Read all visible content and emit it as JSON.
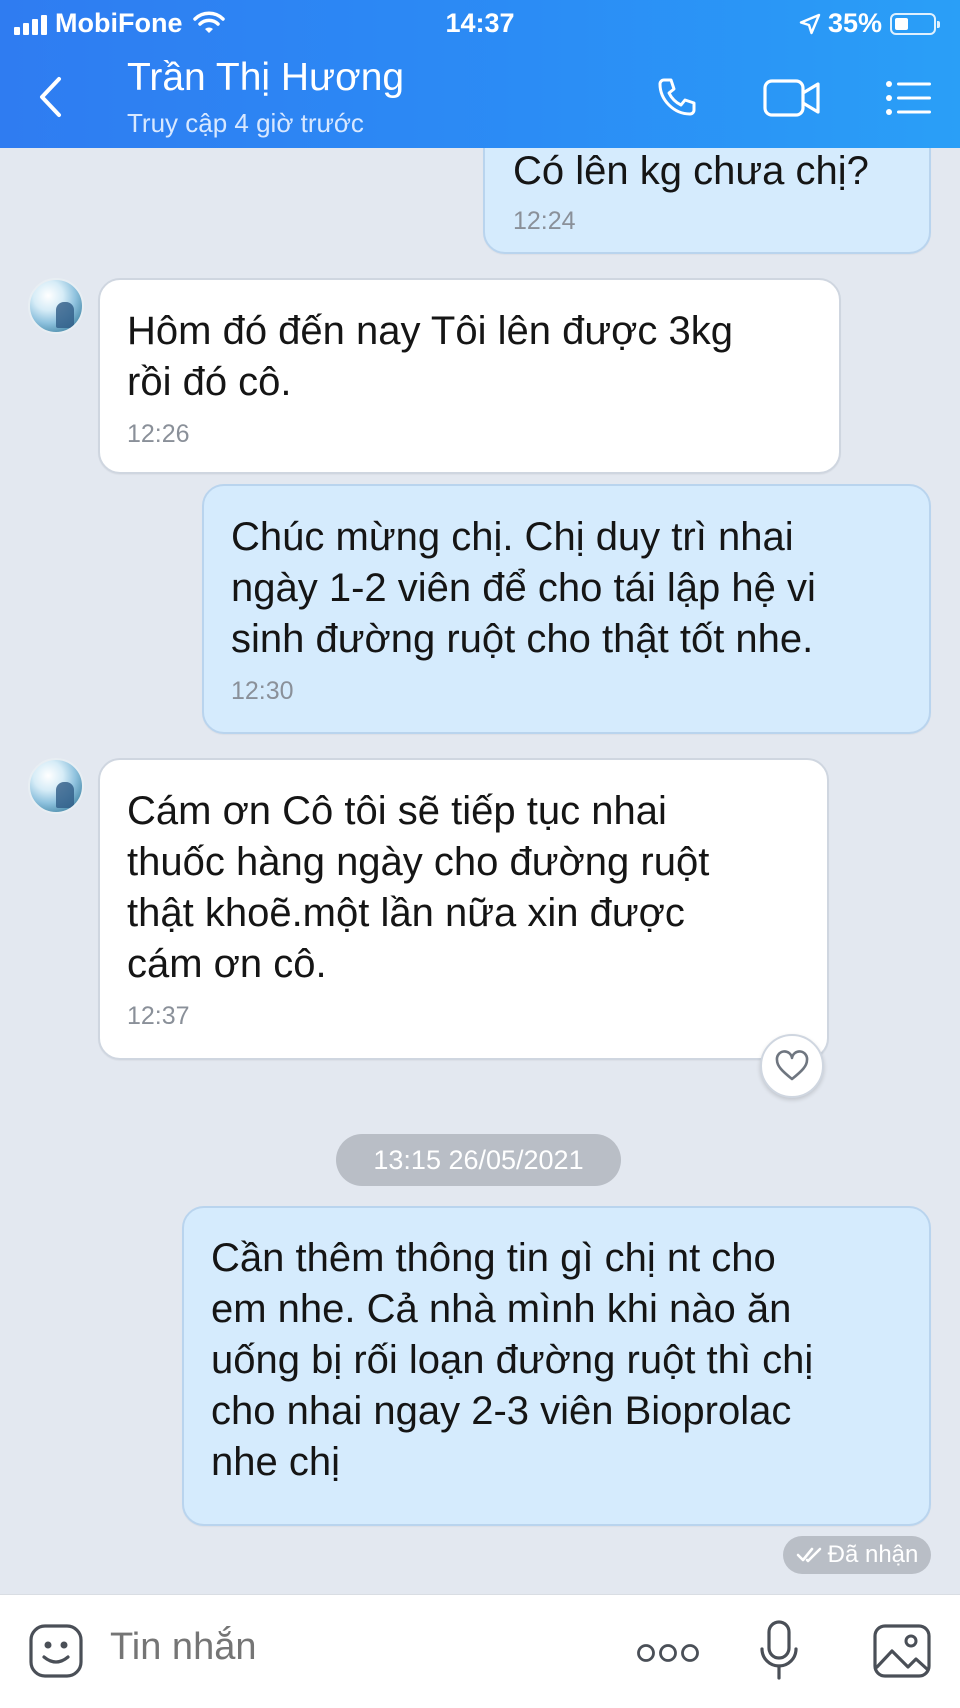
{
  "status_bar": {
    "carrier": "MobiFone",
    "time": "14:37",
    "battery": "35%"
  },
  "header": {
    "contact_name": "Trần Thị Hương",
    "contact_status": "Truy cập 4 giờ trước",
    "icons": [
      "back-chevron-icon",
      "phone-icon",
      "video-call-icon",
      "menu-list-icon"
    ]
  },
  "messages": [
    {
      "direction": "out",
      "text": "Có lên kg chưa chị?",
      "time": "12:24"
    },
    {
      "direction": "in",
      "text": "Hôm đó đến nay Tôi lên được 3kg\nrồi đó cô.",
      "time": "12:26"
    },
    {
      "direction": "out",
      "text": "Chúc mừng chị. Chị duy trì nhai\nngày 1-2 viên để cho tái lập hệ vi\nsinh đường ruột cho thật tốt nhe.",
      "time": "12:30"
    },
    {
      "direction": "in",
      "text": "Cám ơn Cô tôi sẽ tiếp tục nhai\nthuốc hàng ngày cho đường ruột\nthật khoẽ.một lần nữa xin được\ncám ơn cô.",
      "time": "12:37"
    },
    {
      "direction": "out",
      "text": "Cần thêm thông tin gì chị nt cho\nem nhe. Cả nhà mình khi nào ăn\nuống bị rối loạn đường ruột thì chị\ncho nhai ngay 2-3 viên Bioprolac\nnhe chị",
      "time": ""
    }
  ],
  "date_separator": "13:15 26/05/2021",
  "seen_status": "Đã nhận",
  "composer": {
    "placeholder": "Tin nhắn",
    "icons": [
      "emoji-icon",
      "more-dots-icon",
      "microphone-icon",
      "gallery-icon"
    ]
  },
  "colors": {
    "header_blue": "#2f7cf1",
    "background": "#e3e8f0",
    "outgoing_bubble": "#d5ebfd",
    "incoming_bubble": "#ffffff",
    "pill_gray": "#b9bec6"
  }
}
